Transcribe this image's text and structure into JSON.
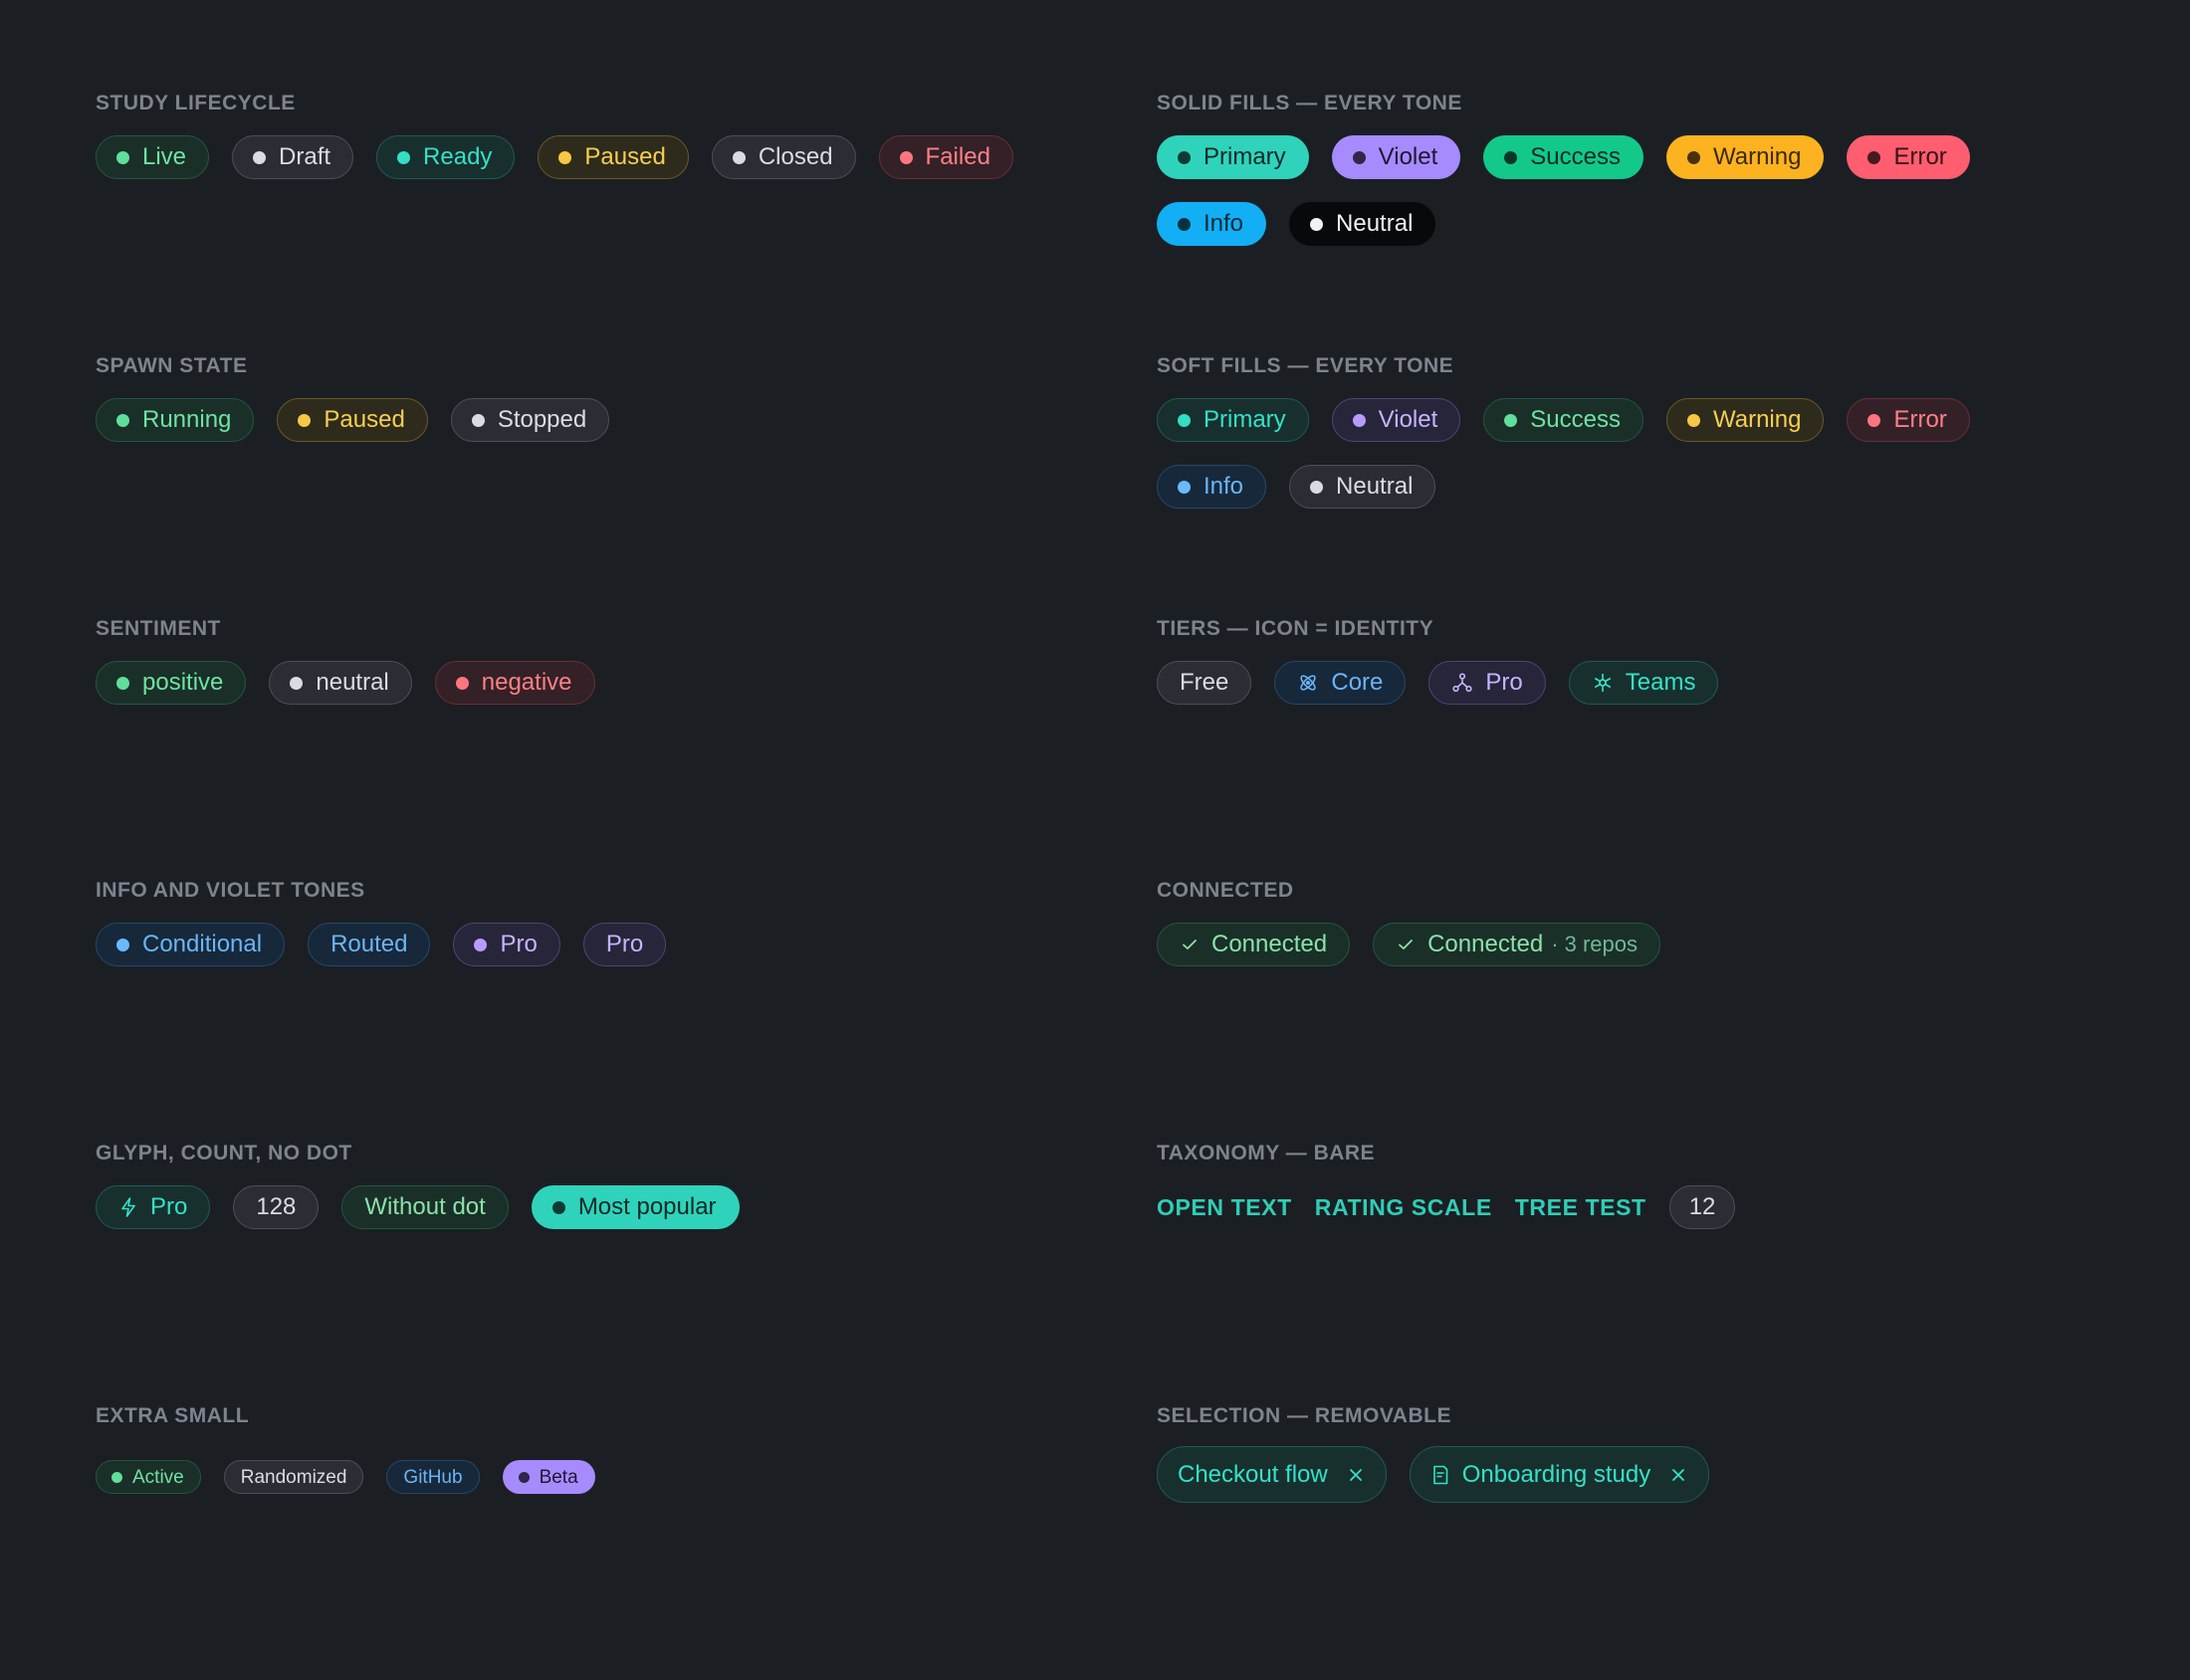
{
  "sections": {
    "study_lifecycle": {
      "title": "STUDY LIFECYCLE",
      "badges": [
        "Live",
        "Draft",
        "Ready",
        "Paused",
        "Closed",
        "Failed"
      ]
    },
    "solid_fills": {
      "title": "SOLID FILLS — EVERY TONE",
      "badges": [
        "Primary",
        "Violet",
        "Success",
        "Warning",
        "Error",
        "Info",
        "Neutral"
      ]
    },
    "spawn_state": {
      "title": "SPAWN STATE",
      "badges": [
        "Running",
        "Paused",
        "Stopped"
      ]
    },
    "soft_fills": {
      "title": "SOFT FILLS — EVERY TONE",
      "badges": [
        "Primary",
        "Violet",
        "Success",
        "Warning",
        "Error",
        "Info",
        "Neutral"
      ]
    },
    "sentiment": {
      "title": "SENTIMENT",
      "badges": [
        "positive",
        "neutral",
        "negative"
      ]
    },
    "tiers": {
      "title": "TIERS — ICON = IDENTITY",
      "badges": [
        "Free",
        "Core",
        "Pro",
        "Teams"
      ]
    },
    "info_violet": {
      "title": "INFO AND VIOLET TONES",
      "badges": [
        "Conditional",
        "Routed",
        "Pro",
        "Pro"
      ]
    },
    "connected": {
      "title": "CONNECTED",
      "badges": [
        "Connected",
        "Connected"
      ],
      "repo_count": "· 3 repos"
    },
    "glyph_count": {
      "title": "GLYPH, COUNT, NO DOT",
      "badges": [
        "Pro",
        "128",
        "Without dot",
        "Most popular"
      ]
    },
    "taxonomy": {
      "title": "TAXONOMY — BARE",
      "items": [
        "OPEN TEXT",
        "RATING SCALE",
        "TREE TEST"
      ],
      "count": "12"
    },
    "extra_small": {
      "title": "EXTRA SMALL",
      "badges": [
        "Active",
        "Randomized",
        "GitHub",
        "Beta"
      ]
    },
    "selection": {
      "title": "SELECTION — REMOVABLE",
      "badges": [
        "Checkout flow",
        "Onboarding study"
      ]
    }
  },
  "colors": {
    "background": "#1b1f24",
    "teal": "#34ddc5",
    "green": "#5fe09a",
    "yellow": "#f6c944",
    "red": "#ff7680",
    "violet": "#b79bff",
    "blue": "#6ab9ff"
  },
  "icons": {
    "tier_core": "atom-icon",
    "tier_pro": "nodes-icon",
    "tier_teams": "snowflake-icon",
    "connected": "check-icon",
    "glyph_pro": "lightning-icon",
    "remove": "close-icon",
    "onboarding": "document-icon"
  }
}
